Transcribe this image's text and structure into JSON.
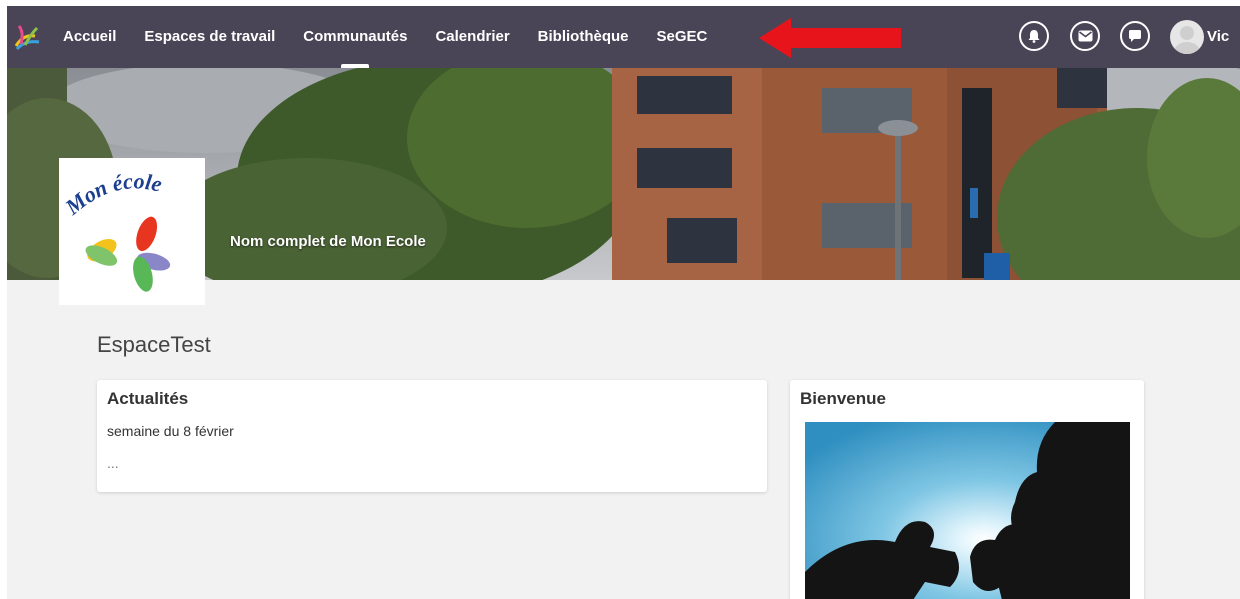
{
  "nav": {
    "items": [
      {
        "label": "Accueil"
      },
      {
        "label": "Espaces de travail"
      },
      {
        "label": "Communautés"
      },
      {
        "label": "Calendrier"
      },
      {
        "label": "Bibliothèque"
      },
      {
        "label": "SeGEC"
      }
    ],
    "active_index": 2,
    "icons": [
      "bell-icon",
      "mail-icon",
      "chat-icon"
    ],
    "user_name": "Vic"
  },
  "banner": {
    "logo_text": "Mon école",
    "school_name": "Nom complet de Mon Ecole"
  },
  "space": {
    "title": "EspaceTest"
  },
  "news": {
    "title": "Actualités",
    "line1": "semaine du 8 février",
    "line2": "..."
  },
  "welcome": {
    "title": "Bienvenue"
  },
  "colors": {
    "nav_bg": "#4a4556",
    "page_bg": "#f2f2f2",
    "annotation_arrow": "#e8141b"
  }
}
